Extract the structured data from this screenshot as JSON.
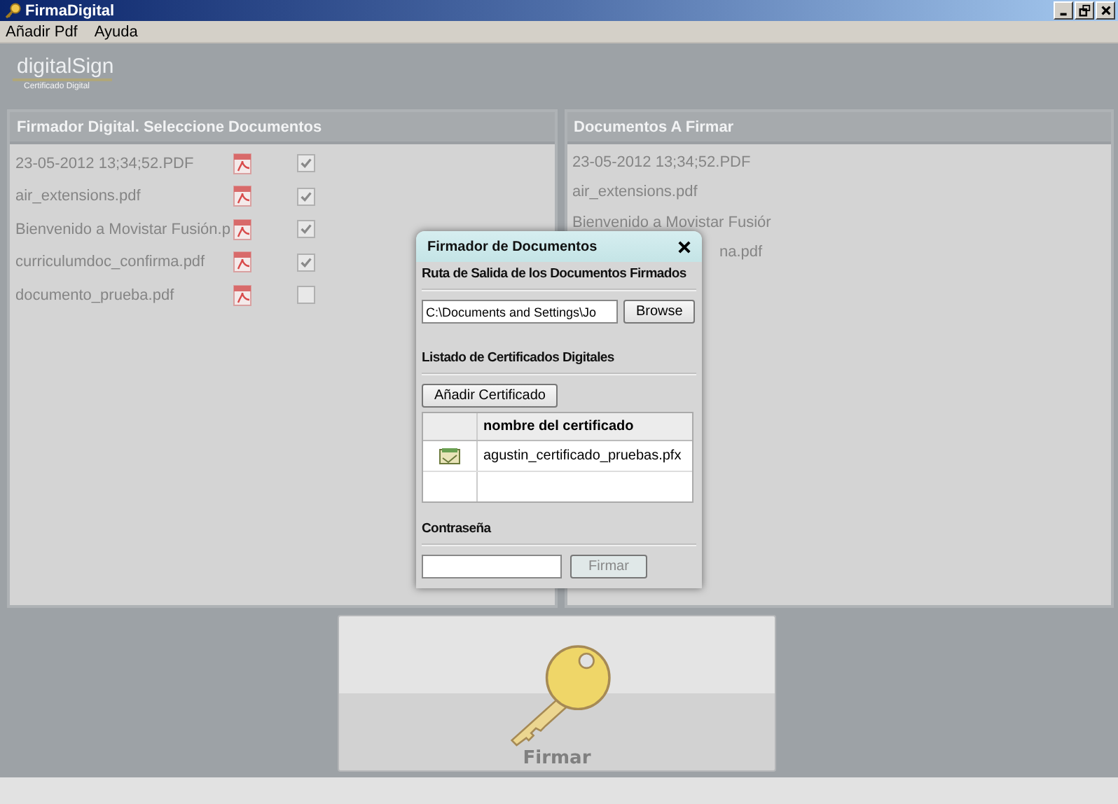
{
  "window": {
    "title": "FirmaDigital"
  },
  "menu": [
    "Añadir Pdf",
    "Ayuda"
  ],
  "logo": {
    "name": "digitalSign",
    "subtitle": "Certificado Digital"
  },
  "left_panel": {
    "title": "Firmador Digital. Seleccione Documentos",
    "documents": [
      {
        "name": "23-05-2012 13;34;52.PDF",
        "checked": true
      },
      {
        "name": "air_extensions.pdf",
        "checked": true
      },
      {
        "name": "Bienvenido a Movistar Fusión.p",
        "checked": true
      },
      {
        "name": "curriculumdoc_confirma.pdf",
        "checked": true
      },
      {
        "name": "documento_prueba.pdf",
        "checked": false
      }
    ]
  },
  "right_panel": {
    "title": "Documentos A Firmar",
    "documents": [
      {
        "name": "23-05-2012 13;34;52.PDF",
        "kind": "full"
      },
      {
        "name": "air_extensions.pdf",
        "kind": "full"
      },
      {
        "name": "Bienvenido a Movistar Fusiór",
        "kind": "full"
      },
      {
        "name": "na.pdf",
        "kind": "partial"
      }
    ]
  },
  "sign_button": {
    "label": "Firmar"
  },
  "dialog": {
    "title": "Firmador de Documentos",
    "output_heading": "Ruta de Salida de los Documentos Firmados",
    "output_path": "C:\\Documents and Settings\\Jo",
    "browse": "Browse",
    "certs_heading": "Listado de Certificados Digitales",
    "add_cert": "Añadir Certificado",
    "table": {
      "columns": [
        "nombre del certificado"
      ],
      "rows": [
        {
          "name": "agustin_certificado_pruebas.pfx"
        }
      ]
    },
    "password_heading": "Contraseña",
    "sign": "Firmar",
    "sign_disabled": true
  }
}
